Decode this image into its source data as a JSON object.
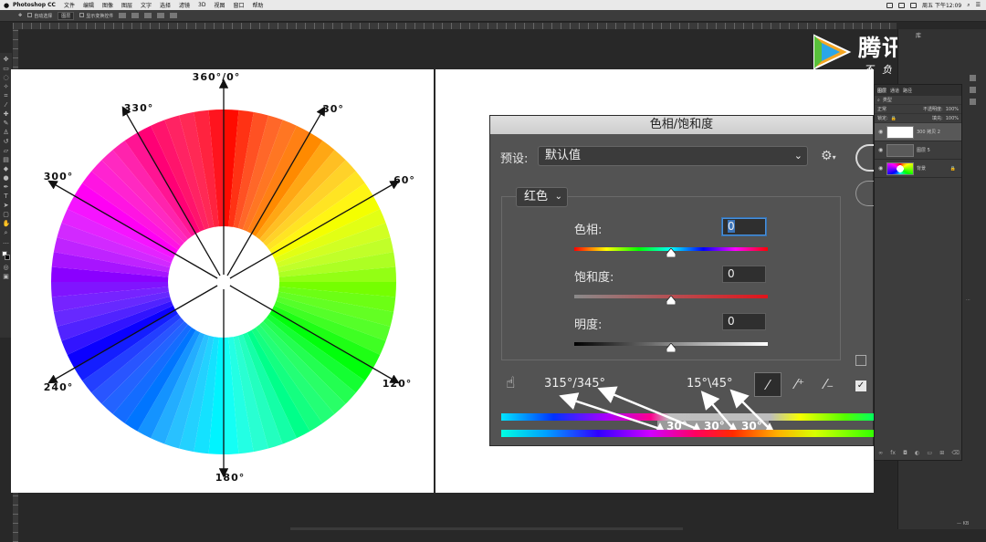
{
  "menubar": {
    "app": "Photoshop CC",
    "items": [
      "文件",
      "编辑",
      "图像",
      "图层",
      "文字",
      "选择",
      "滤镜",
      "3D",
      "视图",
      "窗口",
      "帮助"
    ],
    "clock": "周五 下午12:09"
  },
  "options_bar": {
    "auto_select": "自动选择",
    "target": "图层",
    "show_transform": "显示变换控件"
  },
  "watermark": {
    "title": "腾讯视频",
    "subtitle": "不负好时光"
  },
  "color_wheel": {
    "labels": [
      "360°/0°",
      "30°",
      "60°",
      "120°",
      "180°",
      "240°",
      "300°",
      "330°"
    ]
  },
  "dialog": {
    "title": "色相/饱和度",
    "preset_label": "预设:",
    "preset_value": "默认值",
    "channel_value": "红色",
    "hue_label": "色相:",
    "hue_value": "0",
    "saturation_label": "饱和度:",
    "saturation_value": "0",
    "lightness_label": "明度:",
    "lightness_value": "0",
    "range_left": "315°/345°",
    "range_right": "15°\\45°",
    "segments": [
      "30°",
      "30°",
      "30°"
    ],
    "slider_levels": {
      "hue": 0.5,
      "saturation": 0.5,
      "lightness": 0.5
    }
  },
  "layers_panel": {
    "tabs": [
      "图层",
      "通道",
      "路径"
    ],
    "kind": "类型",
    "blend_mode": "正常",
    "opacity_label": "不透明度:",
    "opacity_value": "100%",
    "lock_label": "锁定:",
    "fill_label": "填充:",
    "fill_value": "100%",
    "layers": [
      {
        "name": "300 拷贝 2",
        "selected": true
      },
      {
        "name": "图层 5",
        "selected": false
      },
      {
        "name": "背景",
        "selected": false
      }
    ]
  },
  "dock": {
    "title": "库",
    "status": "— KB"
  },
  "colors": {
    "dialog_bg": "#535353",
    "focus": "#4a90d9",
    "canvas": "#ffffff",
    "app_bg": "#282828"
  }
}
